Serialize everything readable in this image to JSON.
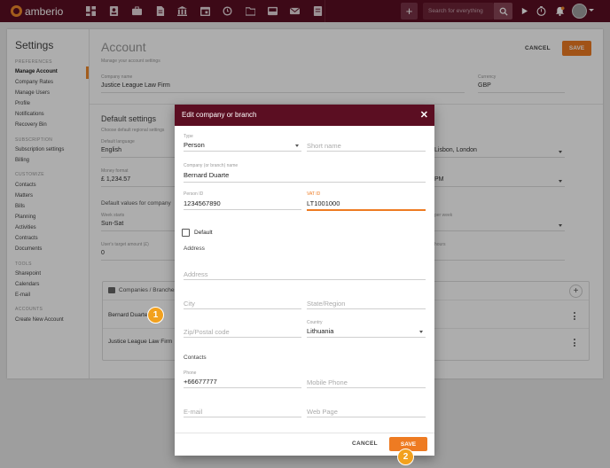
{
  "app": {
    "logo_text": "amberio",
    "brand_color": "#5b0e22",
    "accent_color": "#ee7b22"
  },
  "topbar": {
    "nav_icons": [
      "dashboard-icon",
      "contacts-card-icon",
      "briefcase-icon",
      "document-icon",
      "bank-icon",
      "calendar-icon",
      "history-icon",
      "folder-icon",
      "inbox-icon",
      "mail-icon",
      "invoice-icon"
    ],
    "search_placeholder": "Search for everything",
    "plus_label": "+"
  },
  "sidebar": {
    "title": "Settings",
    "sections": [
      {
        "label": "PREFERENCES",
        "items": [
          "Manage Account",
          "Company Rates",
          "Manage Users",
          "Profile",
          "Notifications",
          "Recovery Bin"
        ]
      },
      {
        "label": "SUBSCRIPTION",
        "items": [
          "Subscription settings",
          "Billing"
        ]
      },
      {
        "label": "CUSTOMIZE",
        "items": [
          "Contacts",
          "Matters",
          "Bills",
          "Planning",
          "Activities",
          "Contracts",
          "Documents"
        ]
      },
      {
        "label": "TOOLS",
        "items": [
          "Sharepoint",
          "Calendars",
          "E-mail"
        ]
      },
      {
        "label": "ACCOUNTS",
        "items": [
          "Create New Account"
        ]
      }
    ]
  },
  "main": {
    "title": "Account",
    "subtitle": "Manage your account settings",
    "cancel_label": "CANCEL",
    "save_label": "SAVE",
    "company_name_label": "Company name",
    "company_name": "Justice League Law Firm",
    "currency_label": "Currency",
    "currency": "GBP",
    "default_settings_title": "Default settings",
    "default_settings_sub": "Choose default regional settings",
    "language_label": "Default language",
    "language": "English",
    "timezone": "Lisbon, London",
    "money_format_label": "Money format",
    "money_format": "£ 1,234.57",
    "time_format": "PM",
    "defaults_for_company": "Default values for company",
    "week_starts_label": "Week starts",
    "week_starts": "Sun-Sat",
    "per_week_label": "per week",
    "users_target_label": "User's target amount (£)",
    "users_target": "0",
    "hours_label": "hours",
    "companies_header": "Companies / Branches",
    "companies": [
      "Bernard Duarte",
      "Justice League Law Firm"
    ]
  },
  "dialog": {
    "title": "Edit company or branch",
    "close": "✕",
    "type_label": "Type",
    "type_value": "Person",
    "short_name_ph": "Short name",
    "company_label": "Company (or branch) name",
    "company_value": "Bernard Duarte",
    "person_id_label": "Person ID",
    "person_id": "1234567890",
    "vat_label": "VAT ID",
    "vat_value": "LT1001000",
    "default_label": "Default",
    "address_section": "Address",
    "address_ph": "Address",
    "city_ph": "City",
    "state_ph": "State/Region",
    "zip_ph": "Zip/Postal code",
    "country_label": "Country",
    "country_value": "Lithuania",
    "contacts_section": "Contacts",
    "phone_label": "Phone",
    "phone_value": "+66677777",
    "mobile_ph": "Mobile Phone",
    "email_ph": "E-mail",
    "web_ph": "Web Page",
    "cancel_label": "CANCEL",
    "save_label": "SAVE"
  },
  "badges": [
    "1",
    "2"
  ]
}
